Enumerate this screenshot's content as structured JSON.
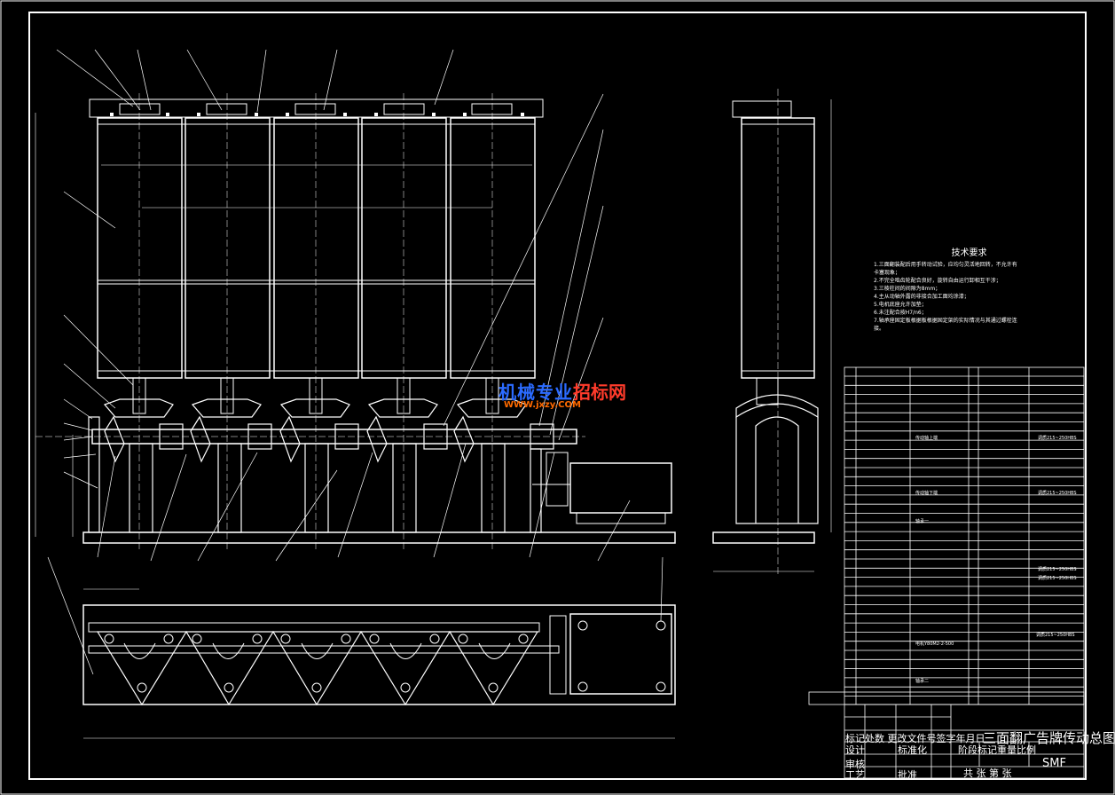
{
  "watermark": {
    "line1_blue": "机械专业",
    "line1_red": "招标网",
    "line2": "WWW.jxzy.COM"
  },
  "technical_requirements": {
    "title": "技术要求",
    "items": [
      "1.三面翻装配后用手转动试验，应均匀灵活地回转，不允许有",
      "  卡塞现象；",
      "2.不完全啮齿轮配合良好，旋转自由运行卸相互干涉；",
      "3.三棱柱间的间隙为8mm；",
      "4.主从动轴外露的非接合加工面均涂漆；",
      "5.电机底座允许加垫；",
      "6.未注配合按H7/n6；",
      "7.轴承座固定板根据板根据固定架的实际情况与其通过螺栓连",
      "  接。"
    ]
  },
  "parts_list_notes": [
    "传动轴上端",
    "调质215~250HBS",
    "传动轴下端",
    "调质215~250HBS",
    "轴承一",
    "调质215~250HBS",
    "调质215~250HBS",
    "电机Y80M2-2-500",
    "调质215~250HBS",
    "轴承二"
  ],
  "title_block": {
    "drawing_title": "三面翻广告牌传动总图",
    "row1": "标记处数  更改文件号签字年月日",
    "design": "设计",
    "standardization": "标准化",
    "stage": "阶段标记重量比例",
    "review": "审核",
    "process": "工艺",
    "approve": "批准",
    "sheets": "共  张    第  张",
    "code": "SMF"
  }
}
